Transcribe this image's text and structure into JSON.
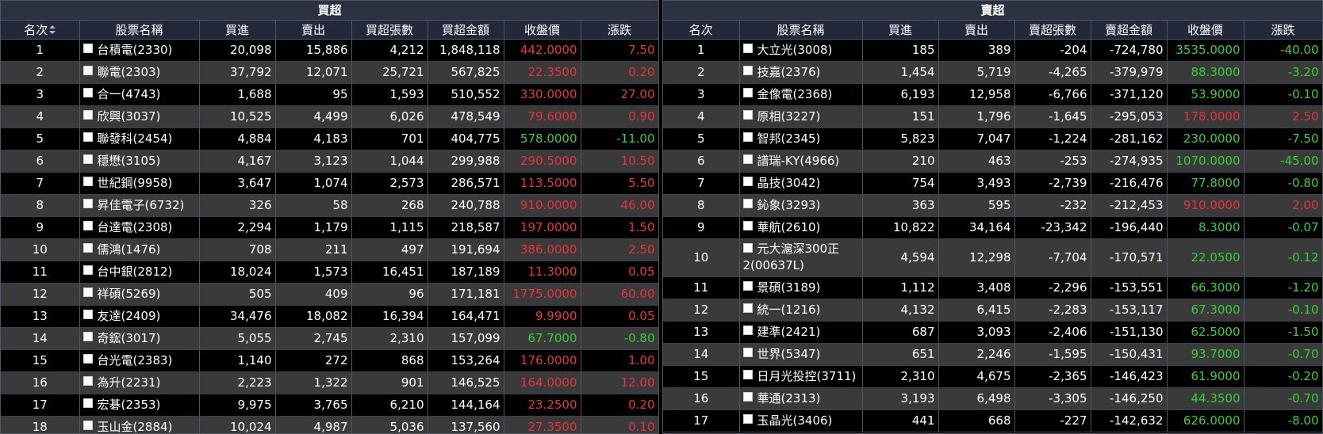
{
  "buy": {
    "title": "買超",
    "headers": [
      "名次",
      "股票名稱",
      "買進",
      "賣出",
      "買超張數",
      "買超金額",
      "收盤價",
      "漲跌"
    ],
    "rows": [
      {
        "rank": "1",
        "name": "台積電(2330)",
        "buy": "20,098",
        "sell": "15,886",
        "net": "4,212",
        "amount": "1,848,118",
        "close": "442.0000",
        "change": "7.50",
        "dir": "up"
      },
      {
        "rank": "2",
        "name": "聯電(2303)",
        "buy": "37,792",
        "sell": "12,071",
        "net": "25,721",
        "amount": "567,825",
        "close": "22.3500",
        "change": "0.20",
        "dir": "up"
      },
      {
        "rank": "3",
        "name": "合一(4743)",
        "buy": "1,688",
        "sell": "95",
        "net": "1,593",
        "amount": "510,552",
        "close": "330.0000",
        "change": "27.00",
        "dir": "up"
      },
      {
        "rank": "4",
        "name": "欣興(3037)",
        "buy": "10,525",
        "sell": "4,499",
        "net": "6,026",
        "amount": "478,549",
        "close": "79.6000",
        "change": "0.90",
        "dir": "up"
      },
      {
        "rank": "5",
        "name": "聯發科(2454)",
        "buy": "4,884",
        "sell": "4,183",
        "net": "701",
        "amount": "404,775",
        "close": "578.0000",
        "change": "-11.00",
        "dir": "down"
      },
      {
        "rank": "6",
        "name": "穩懋(3105)",
        "buy": "4,167",
        "sell": "3,123",
        "net": "1,044",
        "amount": "299,988",
        "close": "290.5000",
        "change": "10.50",
        "dir": "up"
      },
      {
        "rank": "7",
        "name": "世紀鋼(9958)",
        "buy": "3,647",
        "sell": "1,074",
        "net": "2,573",
        "amount": "286,571",
        "close": "113.5000",
        "change": "5.50",
        "dir": "up"
      },
      {
        "rank": "8",
        "name": "昇佳電子(6732)",
        "buy": "326",
        "sell": "58",
        "net": "268",
        "amount": "240,788",
        "close": "910.0000",
        "change": "46.00",
        "dir": "up"
      },
      {
        "rank": "9",
        "name": "台達電(2308)",
        "buy": "2,294",
        "sell": "1,179",
        "net": "1,115",
        "amount": "218,587",
        "close": "197.0000",
        "change": "1.50",
        "dir": "up"
      },
      {
        "rank": "10",
        "name": "儒鴻(1476)",
        "buy": "708",
        "sell": "211",
        "net": "497",
        "amount": "191,694",
        "close": "386.0000",
        "change": "2.50",
        "dir": "up"
      },
      {
        "rank": "11",
        "name": "台中銀(2812)",
        "buy": "18,024",
        "sell": "1,573",
        "net": "16,451",
        "amount": "187,189",
        "close": "11.3000",
        "change": "0.05",
        "dir": "up"
      },
      {
        "rank": "12",
        "name": "祥碩(5269)",
        "buy": "505",
        "sell": "409",
        "net": "96",
        "amount": "171,181",
        "close": "1775.0000",
        "change": "60.00",
        "dir": "up"
      },
      {
        "rank": "13",
        "name": "友達(2409)",
        "buy": "34,476",
        "sell": "18,082",
        "net": "16,394",
        "amount": "164,471",
        "close": "9.9900",
        "change": "0.05",
        "dir": "up"
      },
      {
        "rank": "14",
        "name": "奇鋐(3017)",
        "buy": "5,055",
        "sell": "2,745",
        "net": "2,310",
        "amount": "157,099",
        "close": "67.7000",
        "change": "-0.80",
        "dir": "down"
      },
      {
        "rank": "15",
        "name": "台光電(2383)",
        "buy": "1,140",
        "sell": "272",
        "net": "868",
        "amount": "153,264",
        "close": "176.0000",
        "change": "1.00",
        "dir": "up"
      },
      {
        "rank": "16",
        "name": "為升(2231)",
        "buy": "2,223",
        "sell": "1,322",
        "net": "901",
        "amount": "146,525",
        "close": "164.0000",
        "change": "12.00",
        "dir": "up"
      },
      {
        "rank": "17",
        "name": "宏碁(2353)",
        "buy": "9,975",
        "sell": "3,765",
        "net": "6,210",
        "amount": "144,164",
        "close": "23.2500",
        "change": "0.20",
        "dir": "up"
      },
      {
        "rank": "18",
        "name": "玉山金(2884)",
        "buy": "10,024",
        "sell": "4,987",
        "net": "5,036",
        "amount": "137,560",
        "close": "27.3500",
        "change": "0.10",
        "dir": "up"
      }
    ]
  },
  "sell": {
    "title": "賣超",
    "headers": [
      "名次",
      "股票名稱",
      "買進",
      "賣出",
      "賣超張數",
      "賣超金額",
      "收盤價",
      "漲跌"
    ],
    "rows": [
      {
        "rank": "1",
        "name": "大立光(3008)",
        "buy": "185",
        "sell": "389",
        "net": "-204",
        "amount": "-724,780",
        "close": "3535.0000",
        "change": "-40.00",
        "dir": "down"
      },
      {
        "rank": "2",
        "name": "技嘉(2376)",
        "buy": "1,454",
        "sell": "5,719",
        "net": "-4,265",
        "amount": "-379,979",
        "close": "88.3000",
        "change": "-3.20",
        "dir": "down"
      },
      {
        "rank": "3",
        "name": "金像電(2368)",
        "buy": "6,193",
        "sell": "12,958",
        "net": "-6,766",
        "amount": "-371,120",
        "close": "53.9000",
        "change": "-0.10",
        "dir": "down"
      },
      {
        "rank": "4",
        "name": "原相(3227)",
        "buy": "151",
        "sell": "1,796",
        "net": "-1,645",
        "amount": "-295,053",
        "close": "178.0000",
        "change": "2.50",
        "dir": "up"
      },
      {
        "rank": "5",
        "name": "智邦(2345)",
        "buy": "5,823",
        "sell": "7,047",
        "net": "-1,224",
        "amount": "-281,162",
        "close": "230.0000",
        "change": "-7.50",
        "dir": "down"
      },
      {
        "rank": "6",
        "name": "譜瑞-KY(4966)",
        "buy": "210",
        "sell": "463",
        "net": "-253",
        "amount": "-274,935",
        "close": "1070.0000",
        "change": "-45.00",
        "dir": "down"
      },
      {
        "rank": "7",
        "name": "晶技(3042)",
        "buy": "754",
        "sell": "3,493",
        "net": "-2,739",
        "amount": "-216,476",
        "close": "77.8000",
        "change": "-0.80",
        "dir": "down"
      },
      {
        "rank": "8",
        "name": "鈊象(3293)",
        "buy": "363",
        "sell": "595",
        "net": "-232",
        "amount": "-212,453",
        "close": "910.0000",
        "change": "2.00",
        "dir": "up"
      },
      {
        "rank": "9",
        "name": "華航(2610)",
        "buy": "10,822",
        "sell": "34,164",
        "net": "-23,342",
        "amount": "-196,440",
        "close": "8.3000",
        "change": "-0.07",
        "dir": "down"
      },
      {
        "rank": "10",
        "name": "元大滬深300正2(00637L)",
        "buy": "4,594",
        "sell": "12,298",
        "net": "-7,704",
        "amount": "-170,571",
        "close": "22.0500",
        "change": "-0.12",
        "dir": "down",
        "tall": true
      },
      {
        "rank": "11",
        "name": "景碩(3189)",
        "buy": "1,112",
        "sell": "3,408",
        "net": "-2,296",
        "amount": "-153,551",
        "close": "66.3000",
        "change": "-1.20",
        "dir": "down"
      },
      {
        "rank": "12",
        "name": "統一(1216)",
        "buy": "4,132",
        "sell": "6,415",
        "net": "-2,283",
        "amount": "-153,117",
        "close": "67.3000",
        "change": "-0.10",
        "dir": "down"
      },
      {
        "rank": "13",
        "name": "建準(2421)",
        "buy": "687",
        "sell": "3,093",
        "net": "-2,406",
        "amount": "-151,130",
        "close": "62.5000",
        "change": "-1.50",
        "dir": "down"
      },
      {
        "rank": "14",
        "name": "世界(5347)",
        "buy": "651",
        "sell": "2,246",
        "net": "-1,595",
        "amount": "-150,431",
        "close": "93.7000",
        "change": "-0.70",
        "dir": "down"
      },
      {
        "rank": "15",
        "name": "日月光投控(3711)",
        "buy": "2,310",
        "sell": "4,675",
        "net": "-2,365",
        "amount": "-146,423",
        "close": "61.9000",
        "change": "-0.20",
        "dir": "down"
      },
      {
        "rank": "16",
        "name": "華通(2313)",
        "buy": "3,193",
        "sell": "6,498",
        "net": "-3,305",
        "amount": "-146,250",
        "close": "44.3500",
        "change": "-0.70",
        "dir": "down"
      },
      {
        "rank": "17",
        "name": "玉晶光(3406)",
        "buy": "441",
        "sell": "668",
        "net": "-227",
        "amount": "-142,632",
        "close": "626.0000",
        "change": "-8.00",
        "dir": "down"
      }
    ]
  },
  "colors": {
    "up": "#e8333b",
    "down": "#33d133",
    "header_bg": "#23293a",
    "row_alt": "#3a3a3a"
  }
}
